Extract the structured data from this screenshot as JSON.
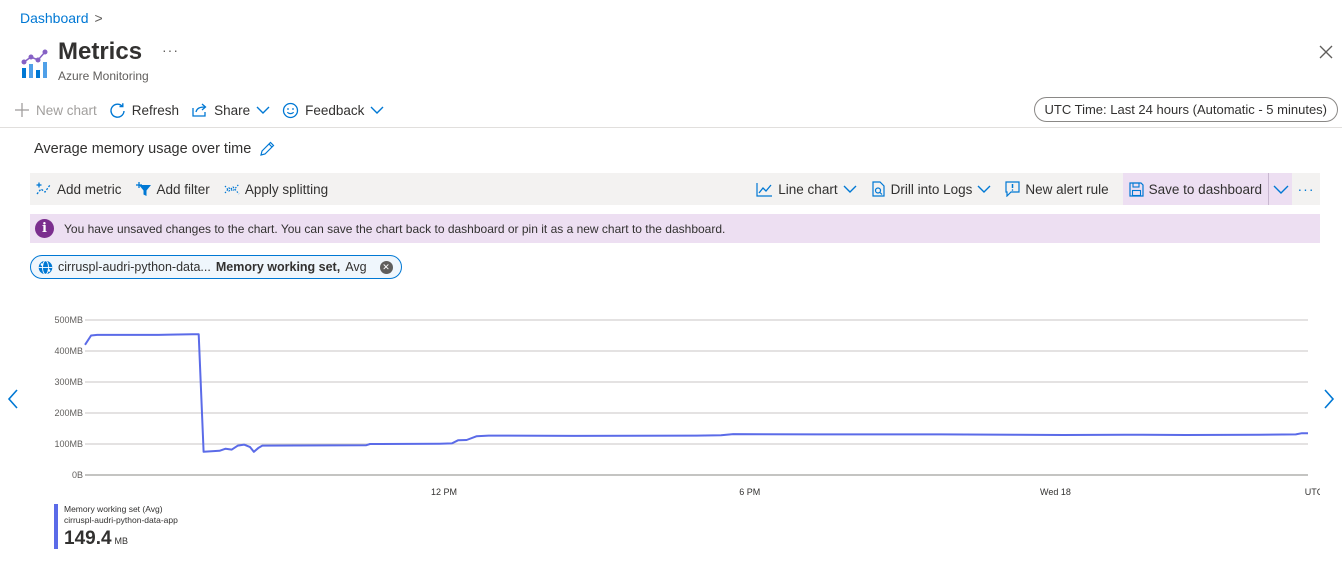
{
  "breadcrumb": {
    "root": "Dashboard",
    "separator": ">"
  },
  "header": {
    "title": "Metrics",
    "subtitle": "Azure Monitoring",
    "more": "···"
  },
  "commands": {
    "new_chart": "New chart",
    "refresh": "Refresh",
    "share": "Share",
    "feedback": "Feedback",
    "time_range": "UTC Time: Last 24 hours (Automatic - 5 minutes)"
  },
  "chart_title": "Average memory usage over time",
  "chart_toolbar": {
    "add_metric": "Add metric",
    "add_filter": "Add filter",
    "apply_splitting": "Apply splitting",
    "line_chart": "Line chart",
    "drill_into_logs": "Drill into Logs",
    "new_alert_rule": "New alert rule",
    "save_to_dashboard": "Save to dashboard",
    "more": "···"
  },
  "banner": {
    "icon": "i",
    "message": "You have unsaved changes to the chart. You can save the chart back to dashboard or pin it as a new chart to the dashboard."
  },
  "metric_pill": {
    "resource": "cirruspl-audri-python-data...",
    "metric": "Memory working set,",
    "aggregation": "Avg",
    "remove": "✕"
  },
  "legend": {
    "metric_name": "Memory working set (Avg)",
    "resource": "cirruspl-audri-python-data-app",
    "value": "149.4",
    "unit": "MB"
  },
  "colors": {
    "accent": "#0078d4",
    "series": "#5b6be8",
    "banner_bg": "#eddff2",
    "info_icon": "#7b2e8e"
  },
  "chart_data": {
    "type": "line",
    "y_ticks": [
      "500MB",
      "400MB",
      "300MB",
      "200MB",
      "100MB",
      "0B"
    ],
    "ylim": [
      0,
      500
    ],
    "x_ticks": [
      {
        "label": "12 PM",
        "t": 0.2935
      },
      {
        "label": "6 PM",
        "t": 0.5435
      },
      {
        "label": "Wed 18",
        "t": 0.7935
      }
    ],
    "x_axis_unit": "UTC",
    "grid": true,
    "series": [
      {
        "name": "Memory working set (Avg)",
        "points": [
          [
            0.0,
            420
          ],
          [
            0.005,
            450
          ],
          [
            0.01,
            452
          ],
          [
            0.06,
            452
          ],
          [
            0.07,
            453
          ],
          [
            0.088,
            454
          ],
          [
            0.093,
            454
          ],
          [
            0.097,
            75
          ],
          [
            0.11,
            78
          ],
          [
            0.115,
            85
          ],
          [
            0.12,
            82
          ],
          [
            0.125,
            95
          ],
          [
            0.13,
            98
          ],
          [
            0.135,
            90
          ],
          [
            0.138,
            75
          ],
          [
            0.142,
            88
          ],
          [
            0.145,
            95
          ],
          [
            0.23,
            96
          ],
          [
            0.233,
            100
          ],
          [
            0.29,
            101
          ],
          [
            0.3,
            102
          ],
          [
            0.305,
            112
          ],
          [
            0.312,
            113
          ],
          [
            0.32,
            125
          ],
          [
            0.33,
            127
          ],
          [
            0.4,
            126
          ],
          [
            0.5,
            127
          ],
          [
            0.52,
            128
          ],
          [
            0.53,
            132
          ],
          [
            0.6,
            131
          ],
          [
            0.7,
            131
          ],
          [
            0.76,
            130
          ],
          [
            0.8,
            129
          ],
          [
            0.85,
            130
          ],
          [
            0.9,
            129
          ],
          [
            0.96,
            130
          ],
          [
            0.99,
            131
          ],
          [
            0.995,
            135
          ],
          [
            1.0,
            135
          ]
        ]
      }
    ]
  }
}
